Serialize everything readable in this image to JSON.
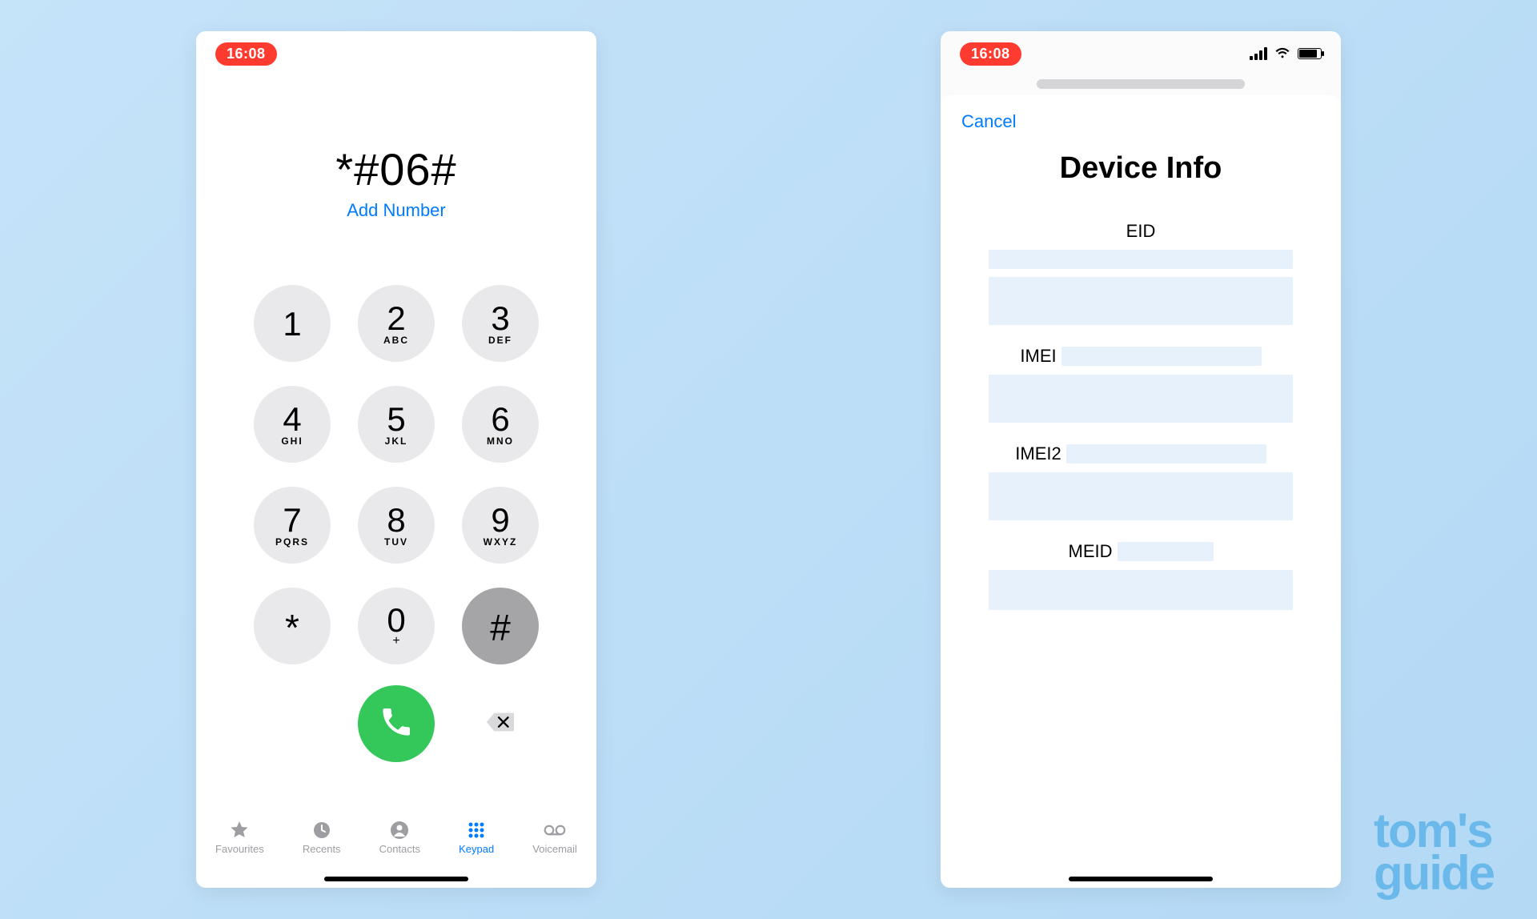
{
  "status": {
    "time": "16:08"
  },
  "dialer": {
    "number": "*#06#",
    "add_number_label": "Add Number",
    "keys": [
      {
        "d": "1",
        "l": ""
      },
      {
        "d": "2",
        "l": "ABC"
      },
      {
        "d": "3",
        "l": "DEF"
      },
      {
        "d": "4",
        "l": "GHI"
      },
      {
        "d": "5",
        "l": "JKL"
      },
      {
        "d": "6",
        "l": "MNO"
      },
      {
        "d": "7",
        "l": "PQRS"
      },
      {
        "d": "8",
        "l": "TUV"
      },
      {
        "d": "9",
        "l": "WXYZ"
      },
      {
        "d": "*",
        "l": ""
      },
      {
        "d": "0",
        "l": "+"
      },
      {
        "d": "#",
        "l": ""
      }
    ]
  },
  "tabs": {
    "favourites": "Favourites",
    "recents": "Recents",
    "contacts": "Contacts",
    "keypad": "Keypad",
    "voicemail": "Voicemail"
  },
  "device_info": {
    "cancel": "Cancel",
    "title": "Device Info",
    "fields": {
      "eid": "EID",
      "imei": "IMEI",
      "imei2": "IMEI2",
      "meid": "MEID"
    }
  },
  "watermark": {
    "line1": "tom's",
    "line2": "guide"
  }
}
